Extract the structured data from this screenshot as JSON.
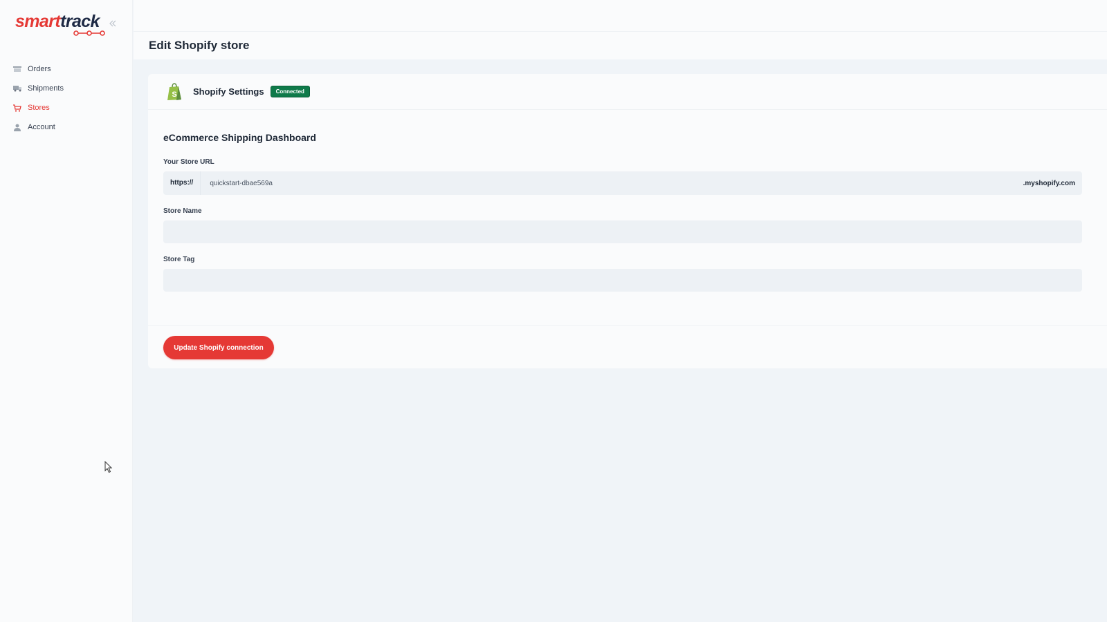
{
  "brand": {
    "name_part1": "smart",
    "name_part2": "track",
    "primary_color": "#e53935",
    "dark_color": "#1e2a45"
  },
  "sidebar": {
    "collapse_icon": "double-chevron-left-icon",
    "items": [
      {
        "label": "Orders",
        "icon": "orders-icon",
        "active": false
      },
      {
        "label": "Shipments",
        "icon": "truck-icon",
        "active": false
      },
      {
        "label": "Stores",
        "icon": "cart-icon",
        "active": true
      },
      {
        "label": "Account",
        "icon": "user-icon",
        "active": false
      }
    ]
  },
  "page": {
    "title": "Edit Shopify store"
  },
  "card": {
    "title": "Shopify Settings",
    "status_badge": "Connected",
    "status_color": "#0f7a4a",
    "logo_icon": "shopify-bag-icon"
  },
  "form": {
    "section_title": "eCommerce Shipping Dashboard",
    "store_url": {
      "label": "Your Store URL",
      "prefix": "https://",
      "value": "quickstart-dbae569a",
      "suffix": ".myshopify.com"
    },
    "store_name": {
      "label": "Store Name",
      "value": ""
    },
    "store_tag": {
      "label": "Store Tag",
      "value": ""
    },
    "submit_label": "Update Shopify connection"
  }
}
